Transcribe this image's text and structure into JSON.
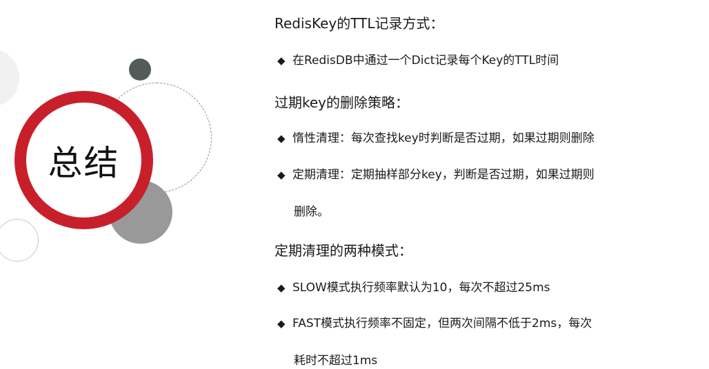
{
  "decor": {
    "title": "总结",
    "colors": {
      "red": "#c8202b",
      "dark_gray": "#535b59",
      "mid_gray": "#999999",
      "light_gray": "#f1f1f1"
    }
  },
  "sections": [
    {
      "heading": "RedisKey的TTL记录方式：",
      "bullets": [
        {
          "lines": [
            "在RedisDB中通过一个Dict记录每个Key的TTL时间"
          ]
        }
      ]
    },
    {
      "heading": "过期key的删除策略：",
      "bullets": [
        {
          "lines": [
            "惰性清理：每次查找key时判断是否过期，如果过期则删除"
          ]
        },
        {
          "lines": [
            "定期清理：定期抽样部分key，判断是否过期，如果过期则",
            "删除。"
          ]
        }
      ]
    },
    {
      "heading": "定期清理的两种模式：",
      "bullets": [
        {
          "lines": [
            "SLOW模式执行频率默认为10，每次不超过25ms"
          ]
        },
        {
          "lines": [
            "FAST模式执行频率不固定，但两次间隔不低于2ms，每次",
            "耗时不超过1ms"
          ]
        }
      ]
    }
  ],
  "icons": {
    "bullet": "diamond-bullet-icon",
    "bullet_glyph": "◆"
  }
}
